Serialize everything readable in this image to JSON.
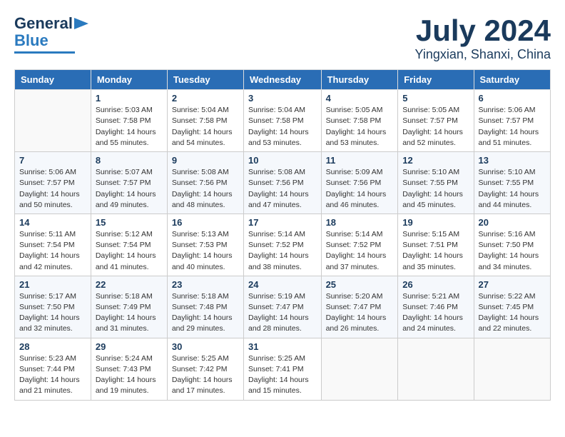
{
  "header": {
    "logo_line1": "General",
    "logo_line2": "Blue",
    "title": "July 2024",
    "location": "Yingxian, Shanxi, China"
  },
  "days_of_week": [
    "Sunday",
    "Monday",
    "Tuesday",
    "Wednesday",
    "Thursday",
    "Friday",
    "Saturday"
  ],
  "weeks": [
    [
      {
        "day": "",
        "info": ""
      },
      {
        "day": "1",
        "info": "Sunrise: 5:03 AM\nSunset: 7:58 PM\nDaylight: 14 hours\nand 55 minutes."
      },
      {
        "day": "2",
        "info": "Sunrise: 5:04 AM\nSunset: 7:58 PM\nDaylight: 14 hours\nand 54 minutes."
      },
      {
        "day": "3",
        "info": "Sunrise: 5:04 AM\nSunset: 7:58 PM\nDaylight: 14 hours\nand 53 minutes."
      },
      {
        "day": "4",
        "info": "Sunrise: 5:05 AM\nSunset: 7:58 PM\nDaylight: 14 hours\nand 53 minutes."
      },
      {
        "day": "5",
        "info": "Sunrise: 5:05 AM\nSunset: 7:57 PM\nDaylight: 14 hours\nand 52 minutes."
      },
      {
        "day": "6",
        "info": "Sunrise: 5:06 AM\nSunset: 7:57 PM\nDaylight: 14 hours\nand 51 minutes."
      }
    ],
    [
      {
        "day": "7",
        "info": "Sunrise: 5:06 AM\nSunset: 7:57 PM\nDaylight: 14 hours\nand 50 minutes."
      },
      {
        "day": "8",
        "info": "Sunrise: 5:07 AM\nSunset: 7:57 PM\nDaylight: 14 hours\nand 49 minutes."
      },
      {
        "day": "9",
        "info": "Sunrise: 5:08 AM\nSunset: 7:56 PM\nDaylight: 14 hours\nand 48 minutes."
      },
      {
        "day": "10",
        "info": "Sunrise: 5:08 AM\nSunset: 7:56 PM\nDaylight: 14 hours\nand 47 minutes."
      },
      {
        "day": "11",
        "info": "Sunrise: 5:09 AM\nSunset: 7:56 PM\nDaylight: 14 hours\nand 46 minutes."
      },
      {
        "day": "12",
        "info": "Sunrise: 5:10 AM\nSunset: 7:55 PM\nDaylight: 14 hours\nand 45 minutes."
      },
      {
        "day": "13",
        "info": "Sunrise: 5:10 AM\nSunset: 7:55 PM\nDaylight: 14 hours\nand 44 minutes."
      }
    ],
    [
      {
        "day": "14",
        "info": "Sunrise: 5:11 AM\nSunset: 7:54 PM\nDaylight: 14 hours\nand 42 minutes."
      },
      {
        "day": "15",
        "info": "Sunrise: 5:12 AM\nSunset: 7:54 PM\nDaylight: 14 hours\nand 41 minutes."
      },
      {
        "day": "16",
        "info": "Sunrise: 5:13 AM\nSunset: 7:53 PM\nDaylight: 14 hours\nand 40 minutes."
      },
      {
        "day": "17",
        "info": "Sunrise: 5:14 AM\nSunset: 7:52 PM\nDaylight: 14 hours\nand 38 minutes."
      },
      {
        "day": "18",
        "info": "Sunrise: 5:14 AM\nSunset: 7:52 PM\nDaylight: 14 hours\nand 37 minutes."
      },
      {
        "day": "19",
        "info": "Sunrise: 5:15 AM\nSunset: 7:51 PM\nDaylight: 14 hours\nand 35 minutes."
      },
      {
        "day": "20",
        "info": "Sunrise: 5:16 AM\nSunset: 7:50 PM\nDaylight: 14 hours\nand 34 minutes."
      }
    ],
    [
      {
        "day": "21",
        "info": "Sunrise: 5:17 AM\nSunset: 7:50 PM\nDaylight: 14 hours\nand 32 minutes."
      },
      {
        "day": "22",
        "info": "Sunrise: 5:18 AM\nSunset: 7:49 PM\nDaylight: 14 hours\nand 31 minutes."
      },
      {
        "day": "23",
        "info": "Sunrise: 5:18 AM\nSunset: 7:48 PM\nDaylight: 14 hours\nand 29 minutes."
      },
      {
        "day": "24",
        "info": "Sunrise: 5:19 AM\nSunset: 7:47 PM\nDaylight: 14 hours\nand 28 minutes."
      },
      {
        "day": "25",
        "info": "Sunrise: 5:20 AM\nSunset: 7:47 PM\nDaylight: 14 hours\nand 26 minutes."
      },
      {
        "day": "26",
        "info": "Sunrise: 5:21 AM\nSunset: 7:46 PM\nDaylight: 14 hours\nand 24 minutes."
      },
      {
        "day": "27",
        "info": "Sunrise: 5:22 AM\nSunset: 7:45 PM\nDaylight: 14 hours\nand 22 minutes."
      }
    ],
    [
      {
        "day": "28",
        "info": "Sunrise: 5:23 AM\nSunset: 7:44 PM\nDaylight: 14 hours\nand 21 minutes."
      },
      {
        "day": "29",
        "info": "Sunrise: 5:24 AM\nSunset: 7:43 PM\nDaylight: 14 hours\nand 19 minutes."
      },
      {
        "day": "30",
        "info": "Sunrise: 5:25 AM\nSunset: 7:42 PM\nDaylight: 14 hours\nand 17 minutes."
      },
      {
        "day": "31",
        "info": "Sunrise: 5:25 AM\nSunset: 7:41 PM\nDaylight: 14 hours\nand 15 minutes."
      },
      {
        "day": "",
        "info": ""
      },
      {
        "day": "",
        "info": ""
      },
      {
        "day": "",
        "info": ""
      }
    ]
  ]
}
